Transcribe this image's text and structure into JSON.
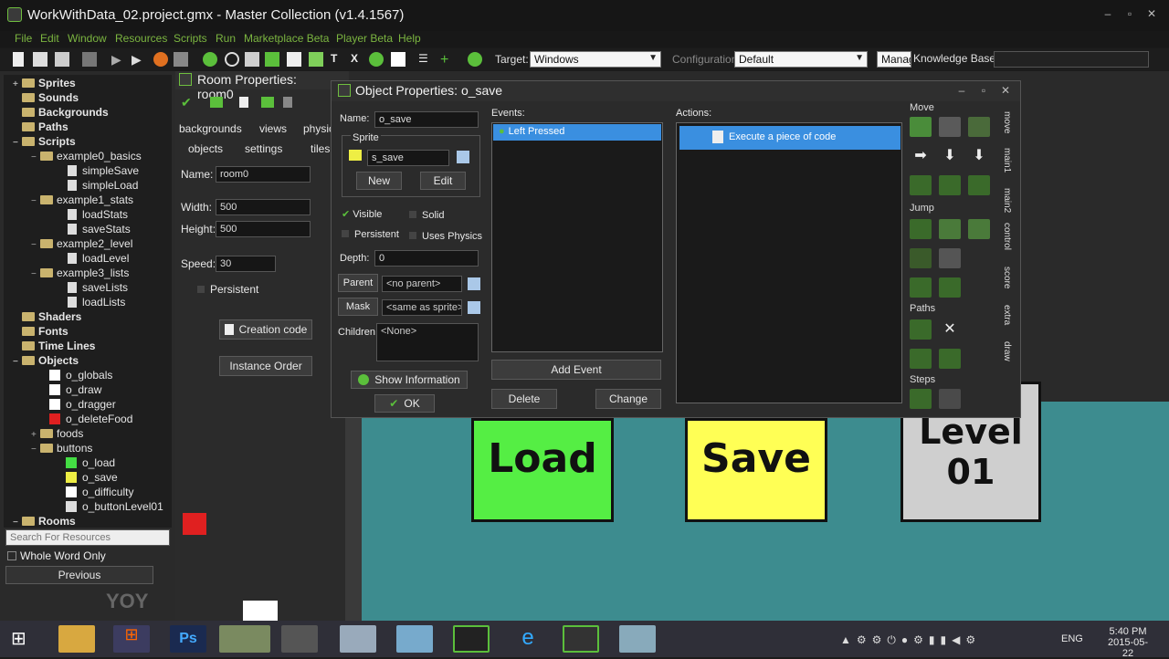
{
  "window": {
    "title": "WorkWithData_02.project.gmx  -  Master Collection (v1.4.1567)"
  },
  "menu": [
    "File",
    "Edit",
    "Window",
    "Resources",
    "Scripts",
    "Run",
    "Marketplace Beta",
    "Player Beta",
    "Help"
  ],
  "toolbar": {
    "target_label": "Target:",
    "target_value": "Windows",
    "config_label": "Configuration",
    "config_value": "Default",
    "manage_label": "Manag",
    "kb_label": "Knowledge Base:"
  },
  "tree": {
    "items": [
      {
        "label": "Sprites",
        "bold": true
      },
      {
        "label": "Sounds",
        "bold": true
      },
      {
        "label": "Backgrounds",
        "bold": true
      },
      {
        "label": "Paths",
        "bold": true
      },
      {
        "label": "Scripts",
        "bold": true
      },
      {
        "label": "example0_basics"
      },
      {
        "label": "simpleSave"
      },
      {
        "label": "simpleLoad"
      },
      {
        "label": "example1_stats"
      },
      {
        "label": "loadStats"
      },
      {
        "label": "saveStats"
      },
      {
        "label": "example2_level"
      },
      {
        "label": "loadLevel"
      },
      {
        "label": "example3_lists"
      },
      {
        "label": "saveLists"
      },
      {
        "label": "loadLists"
      },
      {
        "label": "Shaders",
        "bold": true
      },
      {
        "label": "Fonts",
        "bold": true
      },
      {
        "label": "Time Lines",
        "bold": true
      },
      {
        "label": "Objects",
        "bold": true
      },
      {
        "label": "o_globals"
      },
      {
        "label": "o_draw"
      },
      {
        "label": "o_dragger"
      },
      {
        "label": "o_deleteFood"
      },
      {
        "label": "foods"
      },
      {
        "label": "buttons"
      },
      {
        "label": "o_load"
      },
      {
        "label": "o_save"
      },
      {
        "label": "o_difficulty"
      },
      {
        "label": "o_buttonLevel01"
      },
      {
        "label": "Rooms",
        "bold": true
      }
    ],
    "search_placeholder": "Search For Resources",
    "whole_word": "Whole Word Only",
    "previous": "Previous"
  },
  "room": {
    "title": "Room Properties: room0",
    "tabs_row1": [
      "backgrounds",
      "views",
      "physic"
    ],
    "tabs_row2": [
      "objects",
      "settings",
      "tiles"
    ],
    "name_label": "Name:",
    "name_value": "room0",
    "width_label": "Width:",
    "width_value": "500",
    "height_label": "Height:",
    "height_value": "500",
    "speed_label": "Speed:",
    "speed_value": "30",
    "persistent_label": "Persistent",
    "creation_code": "Creation code",
    "instance_order": "Instance Order"
  },
  "object": {
    "title": "Object Properties: o_save",
    "name_label": "Name:",
    "name_value": "o_save",
    "sprite_label": "Sprite",
    "sprite_value": "s_save",
    "new_btn": "New",
    "edit_btn": "Edit",
    "visible_label": "Visible",
    "solid_label": "Solid",
    "persistent_label": "Persistent",
    "physics_label": "Uses Physics",
    "depth_label": "Depth:",
    "depth_value": "0",
    "parent_btn": "Parent",
    "parent_value": "<no parent>",
    "mask_btn": "Mask",
    "mask_value": "<same as sprite>",
    "children_label": "Children:",
    "children_value": "<None>",
    "show_info": "Show Information",
    "ok": "OK",
    "events_label": "Events:",
    "event_item": "Left Pressed",
    "add_event": "Add Event",
    "delete": "Delete",
    "change": "Change",
    "actions_label": "Actions:",
    "action_item": "Execute a piece of code",
    "groups": {
      "move": "Move",
      "jump": "Jump",
      "paths": "Paths",
      "steps": "Steps"
    },
    "side_tabs": [
      "move",
      "main1",
      "main2",
      "control",
      "score",
      "extra",
      "draw"
    ]
  },
  "canvas": {
    "load": "Load",
    "save": "Save",
    "level": "Level 01",
    "level_line1": "Level",
    "level_line2": "01"
  },
  "taskbar": {
    "time": "5:40 PM",
    "date": "2015-05-22",
    "lang": "ENG"
  },
  "colors": {
    "accent_green": "#7bb540",
    "selection_blue": "#3a8fe0",
    "load_green": "#55ee44",
    "save_yellow": "#ffff55"
  }
}
